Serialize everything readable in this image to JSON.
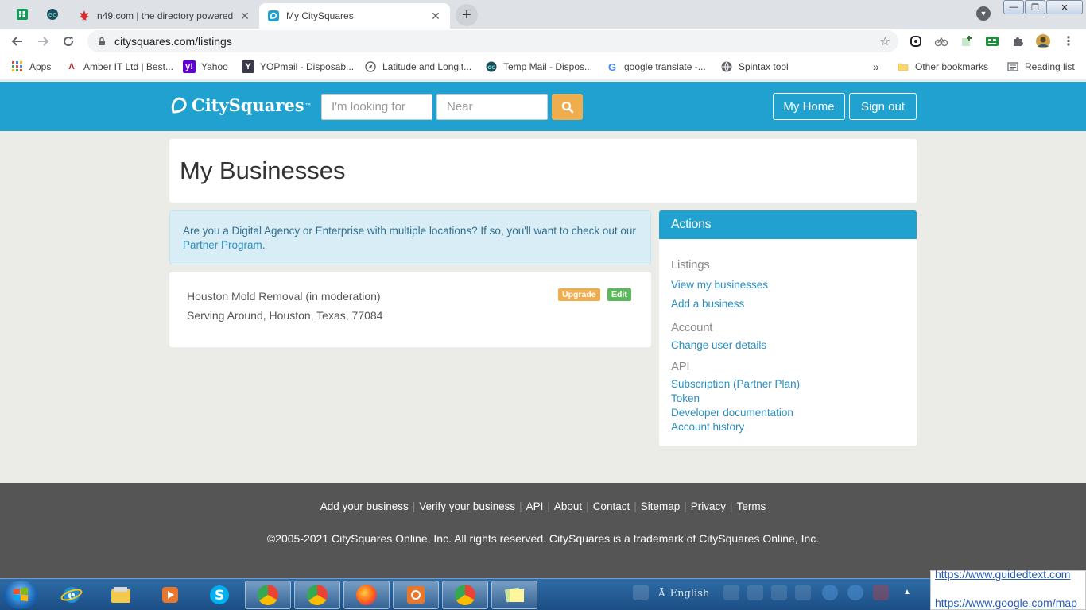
{
  "browser": {
    "tabs": [
      {
        "title": "n49.com | the directory powered",
        "active": false
      },
      {
        "title": "My CitySquares",
        "active": true
      }
    ],
    "new_tab": "+",
    "url": "citysquares.com/listings",
    "bookmarks": [
      {
        "label": "Apps",
        "icon": "apps-grid-icon"
      },
      {
        "label": "Amber IT Ltd | Best...",
        "icon": "amber-icon"
      },
      {
        "label": "Yahoo",
        "icon": "yahoo-icon"
      },
      {
        "label": "YOPmail - Disposab...",
        "icon": "yopmail-icon"
      },
      {
        "label": "Latitude and Longit...",
        "icon": "compass-icon"
      },
      {
        "label": "Temp Mail - Dispos...",
        "icon": "tempmail-icon"
      },
      {
        "label": "google translate -...",
        "icon": "google-icon"
      },
      {
        "label": "Spintax tool",
        "icon": "globe-icon"
      }
    ],
    "bookmarks_overflow": "»",
    "other_bookmarks": "Other bookmarks",
    "reading_list": "Reading list"
  },
  "header": {
    "logo_text": "CitySquares",
    "logo_tm": "™",
    "search_placeholder": "I'm looking for",
    "near_placeholder": "Near",
    "my_home": "My Home",
    "sign_out": "Sign out",
    "brand_color": "#21a1cf",
    "search_btn_color": "#f0ad4e"
  },
  "main": {
    "title": "My Businesses",
    "alert_text": "Are you a Digital Agency or Enterprise with multiple locations? If so, you'll want to check out our ",
    "alert_link": "Partner Program",
    "alert_end": ".",
    "listing": {
      "name": "Houston Mold Removal (in moderation)",
      "address": "Serving Around, Houston, Texas, 77084",
      "upgrade": "Upgrade",
      "edit": "Edit"
    }
  },
  "actions": {
    "title": "Actions",
    "listings_heading": "Listings",
    "view_businesses": "View my businesses",
    "add_business": "Add a business",
    "account_heading": "Account",
    "change_user": "Change user details",
    "api_heading": "API",
    "subscription": "Subscription (Partner Plan)",
    "token": "Token",
    "dev_docs": "Developer documentation",
    "account_history": "Account history"
  },
  "footer": {
    "links": [
      "Add your business",
      "Verify your business",
      "API",
      "About",
      "Contact",
      "Sitemap",
      "Privacy",
      "Terms"
    ],
    "copyright": "©2005-2021 CitySquares Online, Inc. All rights reserved. CitySquares is a trademark of CitySquares Online, Inc."
  },
  "taskbar": {
    "language": "English",
    "tooltip_line1": "https://www.guidedtext.com",
    "tooltip_line2": "https://www.google.com/map"
  }
}
